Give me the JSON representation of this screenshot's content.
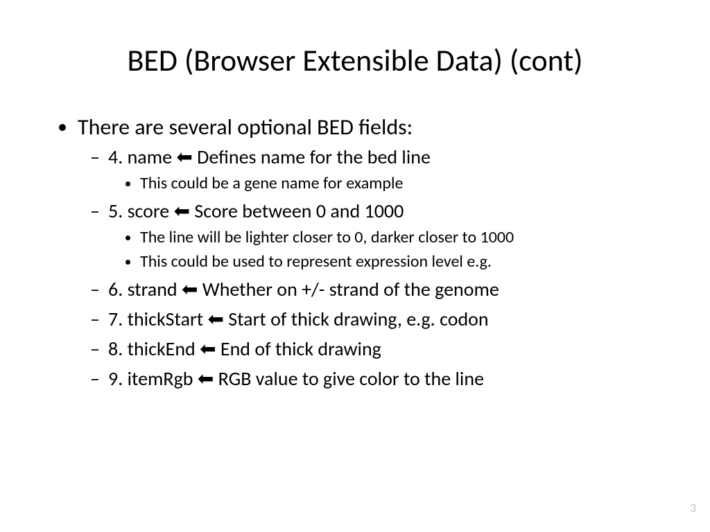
{
  "title": "BED (Browser Extensible Data) (cont)",
  "arrow": "⬅",
  "intro": "There are several optional BED fields:",
  "fields": {
    "f4": {
      "label": "4. name",
      "desc": " Defines name for the bed line",
      "sub": [
        "This could be a gene name for example"
      ]
    },
    "f5": {
      "label": "5. score",
      "desc": " Score between 0 and 1000",
      "sub": [
        "The line will be lighter closer to 0, darker closer to 1000",
        "This could be used to represent expression level e.g."
      ]
    },
    "f6": {
      "label": "6. strand",
      "desc": " Whether on +/- strand of the genome"
    },
    "f7": {
      "label": "7. thickStart",
      "desc": " Start of thick drawing, e.g. codon"
    },
    "f8": {
      "label": "8. thickEnd",
      "desc": " End of thick drawing"
    },
    "f9": {
      "label": "9. itemRgb",
      "desc": " RGB value to give color to the line"
    }
  },
  "page_number": "3"
}
